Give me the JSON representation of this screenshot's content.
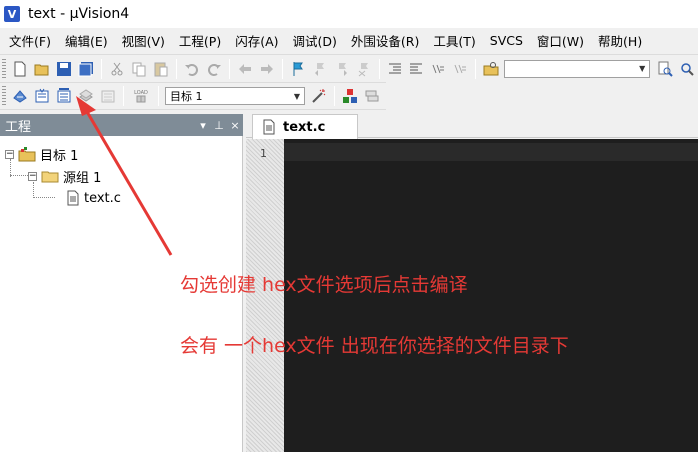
{
  "window": {
    "title": "text  - µVision4",
    "icon_letter": "V"
  },
  "menu": [
    "文件(F)",
    "编辑(E)",
    "视图(V)",
    "工程(P)",
    "闪存(A)",
    "调试(D)",
    "外围设备(R)",
    "工具(T)",
    "SVCS",
    "窗口(W)",
    "帮助(H)"
  ],
  "toolbar1": {
    "find_combo_value": ""
  },
  "toolbar2": {
    "target_combo_value": "目标 1",
    "load_label": "LOAD"
  },
  "project_panel": {
    "title": "工程",
    "controls": [
      "▾",
      "⊥",
      "×"
    ],
    "tree": {
      "target": "目标 1",
      "group": "源组 1",
      "file": "text.c"
    }
  },
  "editor": {
    "tab_label": "text.c",
    "line_numbers": [
      "1"
    ]
  },
  "annotations": {
    "line1": "勾选创建  hex文件选项后点击编译",
    "line2": "会有 一个hex文件 出现在你选择的文件目录下"
  },
  "colors": {
    "annotation": "#e53935",
    "panel_header": "#7f8c97",
    "editor_bg": "#1e1e1e"
  }
}
